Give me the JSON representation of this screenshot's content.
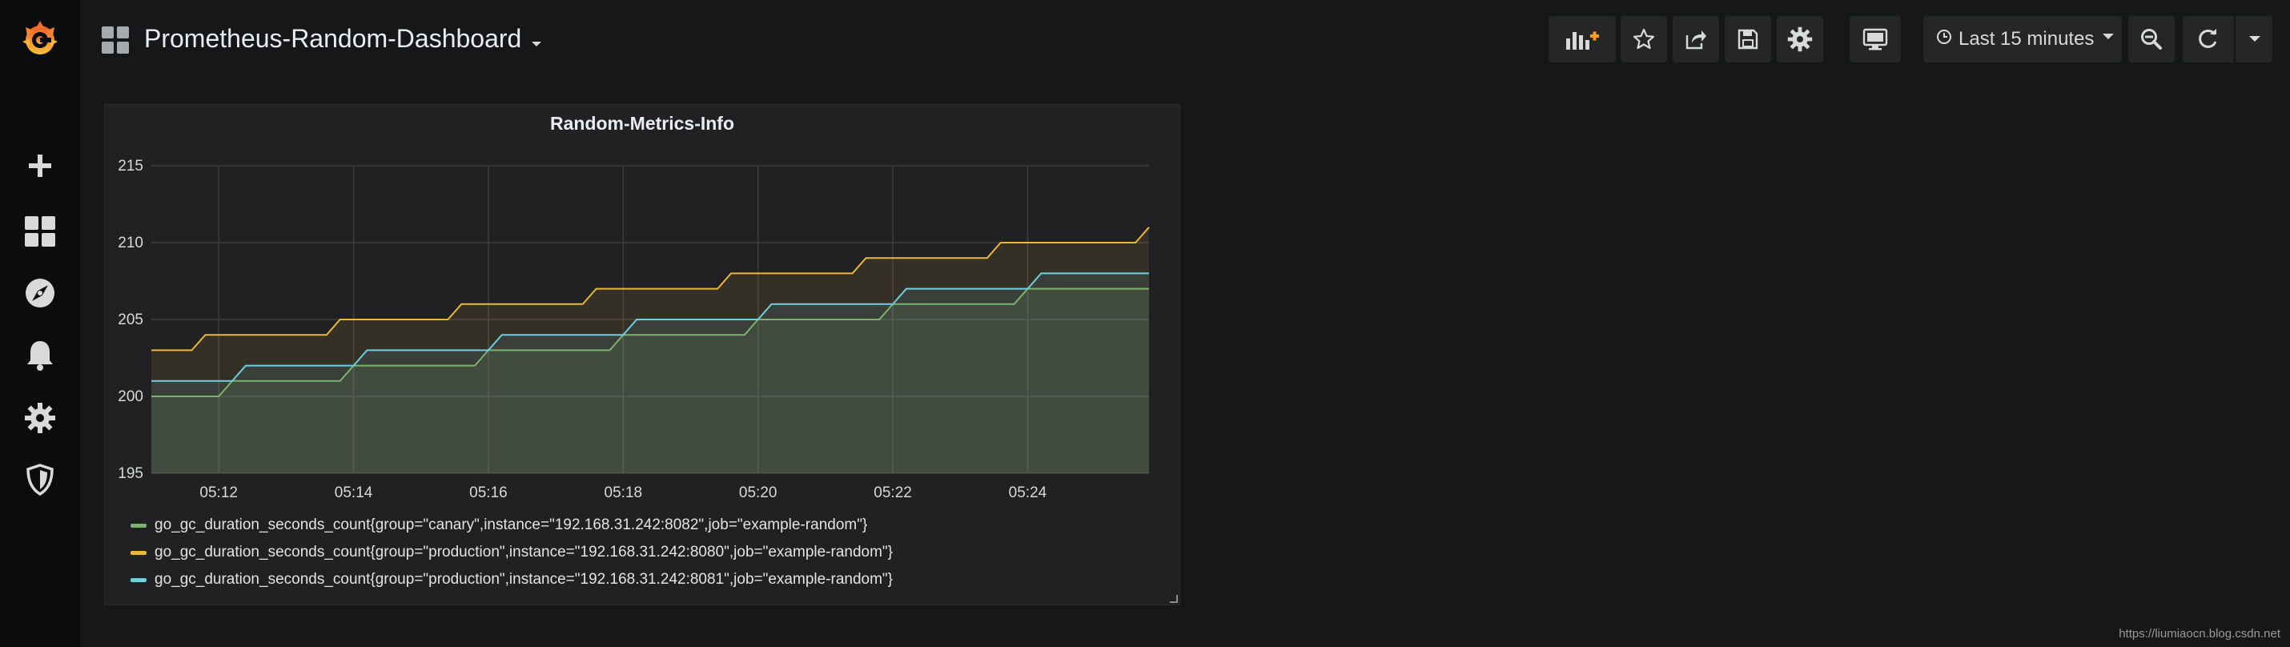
{
  "app": {
    "name": "Grafana"
  },
  "sidebar": {
    "items": [
      {
        "name": "grafana-logo-icon"
      },
      {
        "name": "create-plus-icon"
      },
      {
        "name": "dashboards-icon"
      },
      {
        "name": "explore-compass-icon"
      },
      {
        "name": "alerting-bell-icon"
      },
      {
        "name": "configuration-gear-icon"
      },
      {
        "name": "server-admin-shield-icon"
      }
    ]
  },
  "header": {
    "dashboard_title": "Prometheus-Random-Dashboard",
    "time_range_label": "Last 15 minutes",
    "buttons": [
      "add-panel",
      "star",
      "share",
      "save",
      "settings",
      "cycle-view-mode",
      "time-picker",
      "zoom-out",
      "refresh",
      "refresh-interval"
    ]
  },
  "panel": {
    "title": "Random-Metrics-Info"
  },
  "chart_data": {
    "type": "line",
    "title": "Random-Metrics-Info",
    "xlabel": "",
    "ylabel": "",
    "ylim": [
      195,
      215
    ],
    "yticks": [
      "195",
      "200",
      "205",
      "210",
      "215"
    ],
    "xticks": [
      "05:12",
      "05:14",
      "05:16",
      "05:18",
      "05:20",
      "05:22",
      "05:24"
    ],
    "xtick_minutes": [
      12,
      14,
      16,
      18,
      20,
      22,
      24
    ],
    "xlim_minutes": [
      11,
      25.8
    ],
    "grid": true,
    "legend_placement": "bottom",
    "series": [
      {
        "name": "go_gc_duration_seconds_count{group=\"canary\",instance=\"192.168.31.242:8082\",job=\"example-random\"}",
        "color": "#7eb26d",
        "x": [
          11,
          12,
          12.2,
          13.8,
          14,
          15.8,
          16,
          17.8,
          18,
          19.8,
          20,
          21.8,
          22,
          23.8,
          24,
          25.8
        ],
        "y": [
          200,
          200,
          201,
          201,
          202,
          202,
          203,
          203,
          204,
          204,
          205,
          205,
          206,
          206,
          207,
          207
        ]
      },
      {
        "name": "go_gc_duration_seconds_count{group=\"production\",instance=\"192.168.31.242:8080\",job=\"example-random\"}",
        "color": "#eab839",
        "x": [
          11,
          11.6,
          11.8,
          13.6,
          13.8,
          15.4,
          15.6,
          17.4,
          17.6,
          19.4,
          19.6,
          21.4,
          21.6,
          23.4,
          23.6,
          25.6,
          25.8
        ],
        "y": [
          203,
          203,
          204,
          204,
          205,
          205,
          206,
          206,
          207,
          207,
          208,
          208,
          209,
          209,
          210,
          210,
          211
        ]
      },
      {
        "name": "go_gc_duration_seconds_count{group=\"production\",instance=\"192.168.31.242:8081\",job=\"example-random\"}",
        "color": "#6ed0e0",
        "x": [
          11,
          12.2,
          12.4,
          14.0,
          14.2,
          16.0,
          16.2,
          18.0,
          18.2,
          20.0,
          20.2,
          22.0,
          22.2,
          24.0,
          24.2,
          25.8
        ],
        "y": [
          201,
          201,
          202,
          202,
          203,
          203,
          204,
          204,
          205,
          205,
          206,
          206,
          207,
          207,
          208,
          208
        ]
      }
    ]
  },
  "footer": {
    "watermark": "https://liumiaocn.blog.csdn.net"
  }
}
